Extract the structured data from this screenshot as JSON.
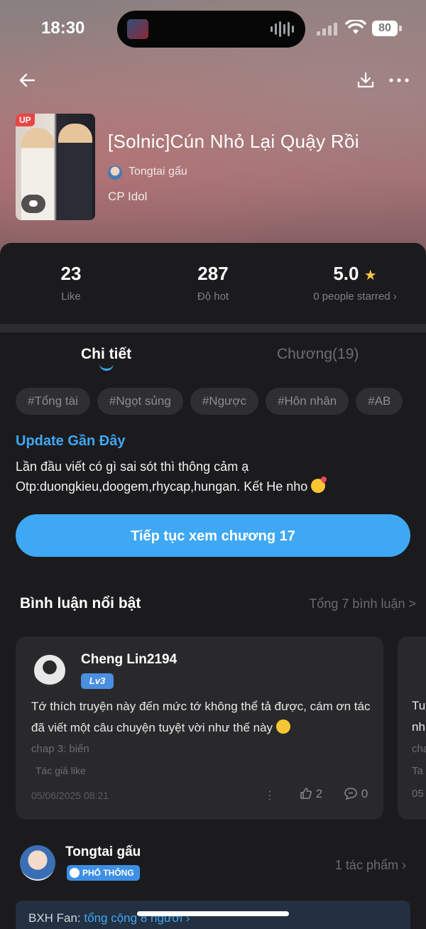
{
  "status_bar": {
    "time": "18:30",
    "battery": "80"
  },
  "book": {
    "cover_badge": "UP",
    "title": "[Solnic]Cún Nhỏ Lại Quậy Rồi",
    "author": "Tongtai gấu",
    "category": "CP Idol"
  },
  "stats": {
    "likes_value": "23",
    "likes_label": "Like",
    "hot_value": "287",
    "hot_label": "Độ hot",
    "rating_value": "5.0",
    "rating_label": "0 people starred ›"
  },
  "tabs": {
    "detail": "Chi tiết",
    "chapters": "Chương(19)"
  },
  "tags": [
    "#Tổng tài",
    "#Ngọt sủng",
    "#Ngược",
    "#Hôn nhân",
    "#AB"
  ],
  "update": {
    "title": "Update Gần Đây",
    "line1": "Lần đầu viết có gì sai sót thì thông cảm ạ",
    "line2": "Otp:duongkieu,doogem,rhycap,hungan. Kết He nho"
  },
  "cta_label": "Tiếp tục xem chương 17",
  "comments": {
    "title": "Bình luận nổi bật",
    "total": "Tổng 7 bình luận >",
    "featured": {
      "user": "Cheng Lin2194",
      "level": "Lv3",
      "text": "Tớ thích truyện này đến mức tớ không thể tả được, cám ơn tác đã viết một câu chuyện tuyệt vời như thế này",
      "chapter": "chap 3: biển",
      "author_liked": "Tác giả like",
      "date": "05/06/2025 08:21",
      "more": "⋮",
      "likes": "2",
      "replies": "0"
    },
    "peek": {
      "line1": "Tu",
      "line2": "nh",
      "line3": "cha",
      "line4": "Ta",
      "date": "05"
    }
  },
  "author_row": {
    "name": "Tongtai gấu",
    "badge": "PHỔ THÔNG",
    "works": "1 tác phẩm"
  },
  "fan_bar": {
    "label": "BXH Fan: ",
    "link": "tổng cộng 8 người ›"
  },
  "colors": {
    "accent": "#3fa8f4",
    "background": "#1b1b1d",
    "star": "#f6c544"
  }
}
